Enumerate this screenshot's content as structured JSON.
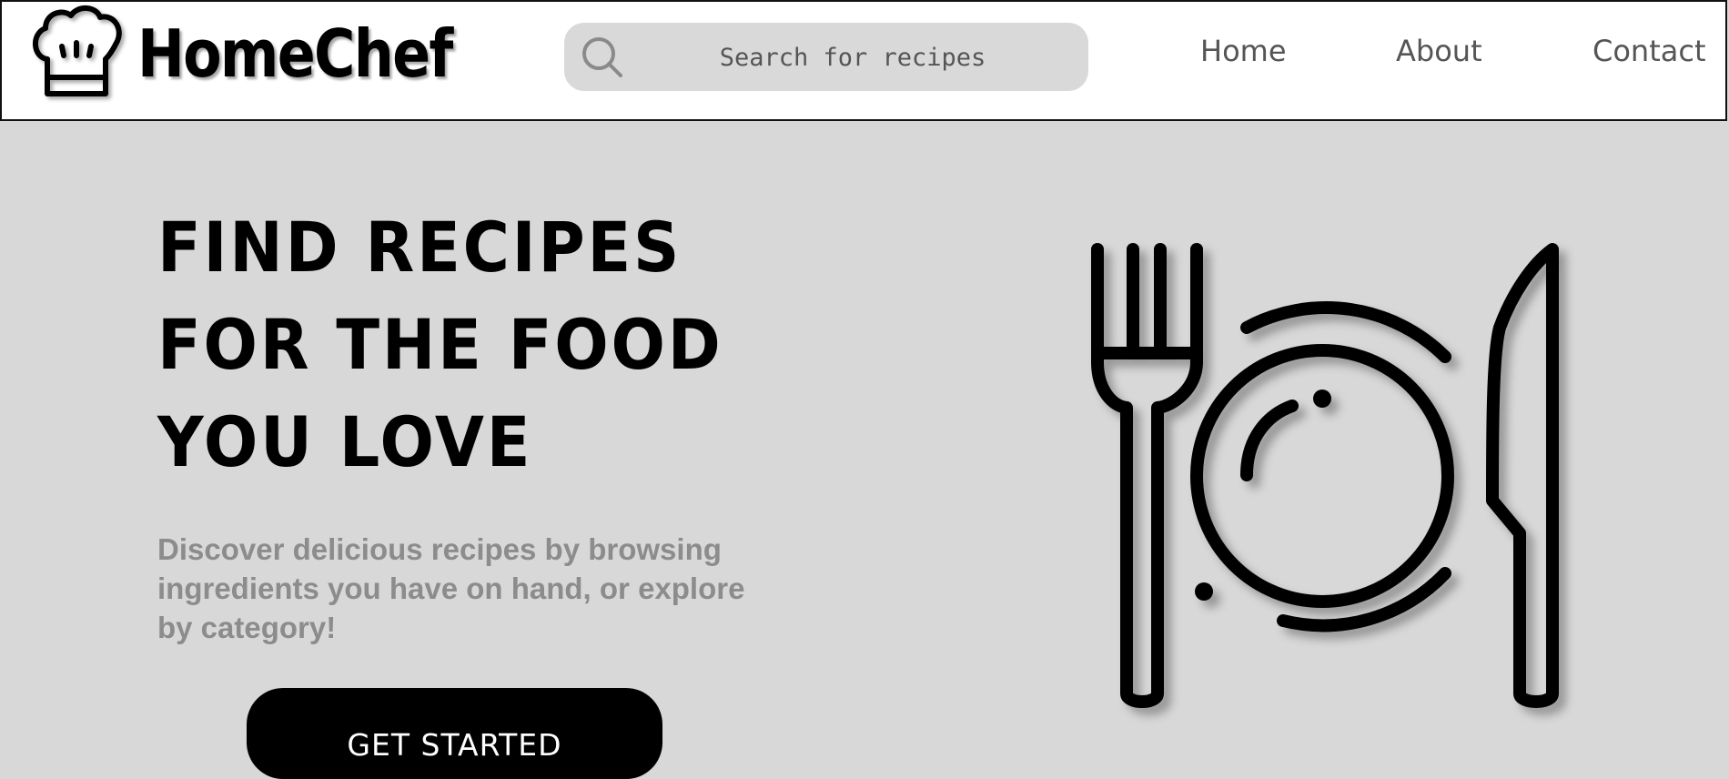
{
  "header": {
    "brand": "HomeChef",
    "logo_icon": "chef-hat-icon",
    "search": {
      "placeholder": "Search for recipes",
      "icon": "search-icon"
    },
    "nav": [
      {
        "label": "Home"
      },
      {
        "label": "About"
      },
      {
        "label": "Contact"
      }
    ]
  },
  "hero": {
    "title_lines": [
      "FIND RECIPES",
      "FOR THE FOOD",
      "YOU LOVE"
    ],
    "description": "Discover delicious recipes by browsing ingredients you have on hand, or explore by category!",
    "cta_label": "GET STARTED",
    "illustration": "fork-plate-knife-icon"
  },
  "colors": {
    "header_bg": "#ffffff",
    "page_bg": "#d8d8d8",
    "search_bg": "#d9d9d9",
    "cta_bg": "#000000",
    "cta_text": "#ffffff",
    "nav_text": "#555555",
    "description_text": "#8c8c8c"
  }
}
